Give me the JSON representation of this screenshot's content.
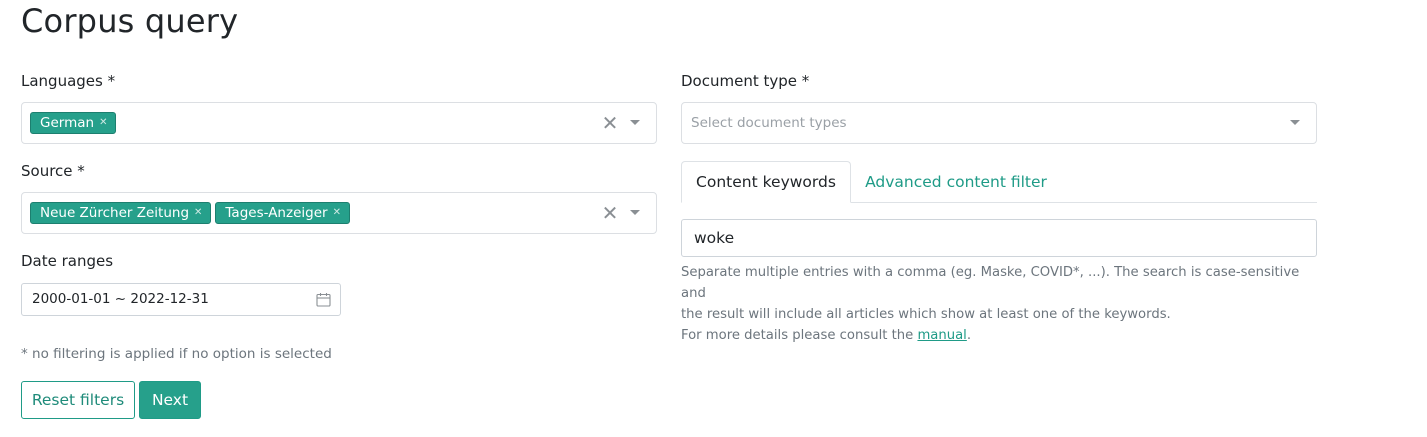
{
  "page": {
    "title": "Corpus query"
  },
  "languages": {
    "label": "Languages *",
    "tags": [
      "German"
    ],
    "clear_icon": "close-icon",
    "caret_icon": "chevron-down-icon"
  },
  "source": {
    "label": "Source *",
    "tags": [
      "Neue Zürcher Zeitung",
      "Tages-Anzeiger"
    ]
  },
  "date": {
    "label": "Date ranges",
    "value": "2000-01-01 ~ 2022-12-31",
    "icon": "calendar-icon"
  },
  "hint": "* no filtering is applied if no option is selected",
  "buttons": {
    "reset": "Reset filters",
    "next": "Next"
  },
  "document_type": {
    "label": "Document type *",
    "placeholder": "Select document types"
  },
  "tabs": [
    {
      "label": "Content keywords",
      "active": true
    },
    {
      "label": "Advanced content filter",
      "active": false
    }
  ],
  "keywords": {
    "value": "woke",
    "help_line1": "Separate multiple entries with a comma (eg. Maske, COVID*, ...). The search is case-sensitive and",
    "help_line2": "the result will include all articles which show at least one of the keywords.",
    "help_line3_prefix": "For more details please consult the ",
    "help_link": "manual",
    "help_line3_suffix": "."
  },
  "colors": {
    "accent": "#26a08b",
    "accent_text": "#1f9b87"
  }
}
